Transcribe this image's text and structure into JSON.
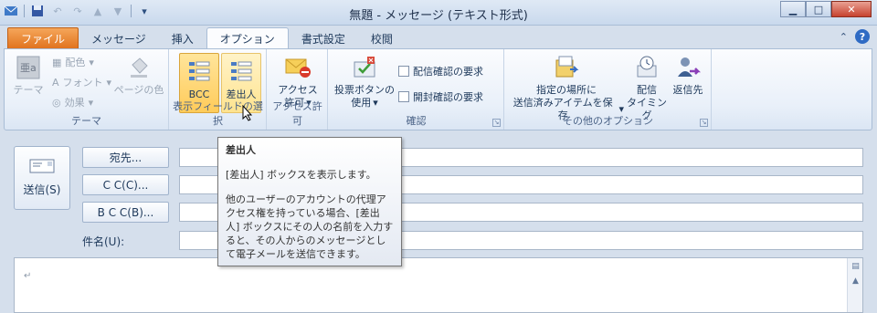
{
  "window": {
    "title": "無題 - メッセージ (テキスト形式)",
    "min_symbol": "▁",
    "max_symbol": "□",
    "close_symbol": "✕"
  },
  "qat": {
    "icons": [
      "outlook-icon",
      "save-icon",
      "undo-icon",
      "redo-icon",
      "up-arrow-icon",
      "down-arrow-icon",
      "customize-icon"
    ]
  },
  "tabs": [
    {
      "label": "ファイル",
      "type": "file"
    },
    {
      "label": "メッセージ",
      "type": "normal"
    },
    {
      "label": "挿入",
      "type": "normal"
    },
    {
      "label": "オプション",
      "type": "active"
    },
    {
      "label": "書式設定",
      "type": "normal"
    },
    {
      "label": "校閲",
      "type": "normal"
    }
  ],
  "ribbon": {
    "theme_group": {
      "label": "テーマ",
      "theme_btn": "テーマ",
      "colors": "配色",
      "fonts": "フォント",
      "effects": "効果",
      "page_color": "ページの色"
    },
    "fields_group": {
      "label": "表示フィールドの選択",
      "bcc": "BCC",
      "from": "差出人"
    },
    "permission_group": {
      "label": "アクセス許可",
      "btn_line1": "アクセス",
      "btn_line2": "許可"
    },
    "tracking_group": {
      "label": "確認",
      "voting_line1": "投票ボタンの",
      "voting_line2": "使用",
      "delivery_receipt": "配信確認の要求",
      "read_receipt": "開封確認の要求"
    },
    "more_group": {
      "label": "その他のオプション",
      "save_line1": "指定の場所に",
      "save_line2": "送信済みアイテムを保存",
      "delay_line1": "配信",
      "delay_line2": "タイミング",
      "reply": "返信先"
    }
  },
  "form": {
    "send": "送信(S)",
    "to": "宛先...",
    "cc": "C C(C)...",
    "bcc": "B C C(B)...",
    "subject": "件名(U):",
    "paragraph_mark": "↵"
  },
  "tooltip": {
    "title": "差出人",
    "desc": "[差出人] ボックスを表示します。",
    "body": "他のユーザーのアカウントの代理アクセス権を持っている場合、[差出人] ボックスにその人の名前を入力すると、その人からのメッセージとして電子メールを送信できます。"
  },
  "colors": {
    "accent": "#e0711c",
    "ribbon_bg": "#e9f0f9",
    "pressed": "#ffcb59"
  }
}
